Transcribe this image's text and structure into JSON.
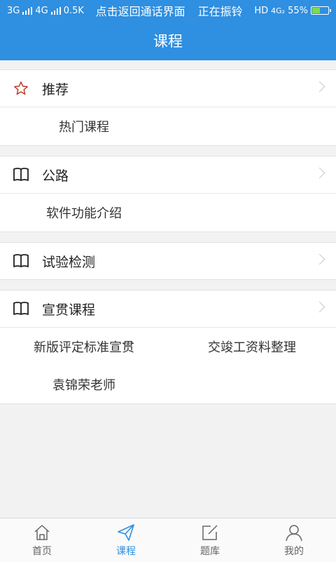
{
  "status_bar": {
    "left": [
      "3G",
      "4G",
      "0.5K"
    ],
    "notification": "点击返回通话界面",
    "call_status": "正在振铃",
    "right": [
      "HD",
      "4G₂",
      "55%"
    ],
    "battery_level": 0.55,
    "battery_color": "#7ed957"
  },
  "header": {
    "title": "课程"
  },
  "sections": [
    {
      "title": "推荐",
      "icon": "star-icon",
      "items": [
        "热门课程"
      ]
    },
    {
      "title": "公路",
      "icon": "book-icon",
      "items": [
        "软件功能介绍"
      ]
    },
    {
      "title": "试验检测",
      "icon": "book-icon",
      "items": []
    },
    {
      "title": "宣贯课程",
      "icon": "book-icon",
      "items": [
        "新版评定标准宣贯",
        "交竣工资料整理",
        "袁锦荣老师"
      ]
    }
  ],
  "bottom_nav": [
    {
      "label": "首页",
      "icon": "home-icon",
      "active": false
    },
    {
      "label": "课程",
      "icon": "send-icon",
      "active": true
    },
    {
      "label": "题库",
      "icon": "edit-icon",
      "active": false
    },
    {
      "label": "我的",
      "icon": "user-icon",
      "active": false
    }
  ],
  "colors": {
    "primary": "#2f8fe0",
    "background": "#f2f2f2",
    "star": "#c0392b"
  }
}
